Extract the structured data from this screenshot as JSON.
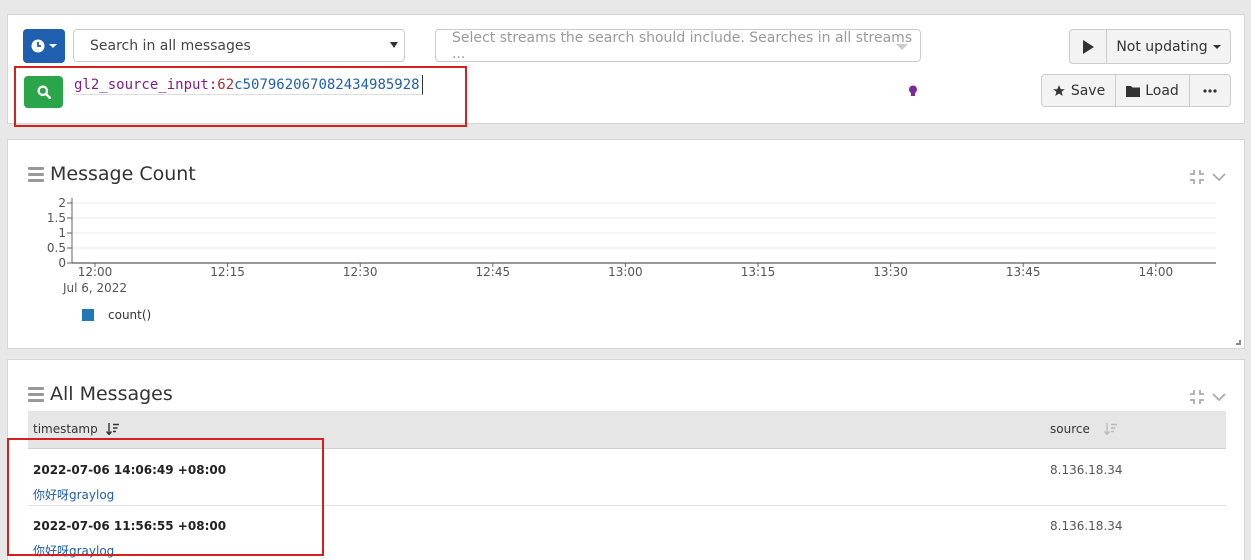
{
  "search": {
    "range_label": "Search in all messages",
    "streams_placeholder": "Select streams the search should include. Searches in all streams ...",
    "refresh_label": "Not updating",
    "query_key": "gl2_source_input:",
    "query_num1": "62",
    "query_num2": "c507962067082434985928",
    "save_label": "Save",
    "load_label": "Load"
  },
  "count_widget": {
    "title": "Message Count"
  },
  "chart_data": {
    "type": "line",
    "y_ticks": [
      "2",
      "1.5",
      "1",
      "0.5",
      "0"
    ],
    "ylim": [
      0,
      2
    ],
    "x_ticks": [
      "12:00",
      "12:15",
      "12:30",
      "12:45",
      "13:00",
      "13:15",
      "13:30",
      "13:45",
      "14:00"
    ],
    "x_date_label": "Jul 6, 2022",
    "grid": true,
    "series": [
      {
        "name": "count()",
        "color": "#1f77b4",
        "x": [],
        "y": []
      }
    ],
    "legend_position": "bottom-left"
  },
  "messages_widget": {
    "title": "All Messages",
    "columns": [
      "timestamp",
      "source"
    ],
    "rows": [
      {
        "timestamp": "2022-07-06 14:06:49 +08:00",
        "message": "你好呀graylog",
        "source": "8.136.18.34"
      },
      {
        "timestamp": "2022-07-06 11:56:55 +08:00",
        "message": "你好呀graylog",
        "source": "8.136.18.34"
      }
    ]
  }
}
